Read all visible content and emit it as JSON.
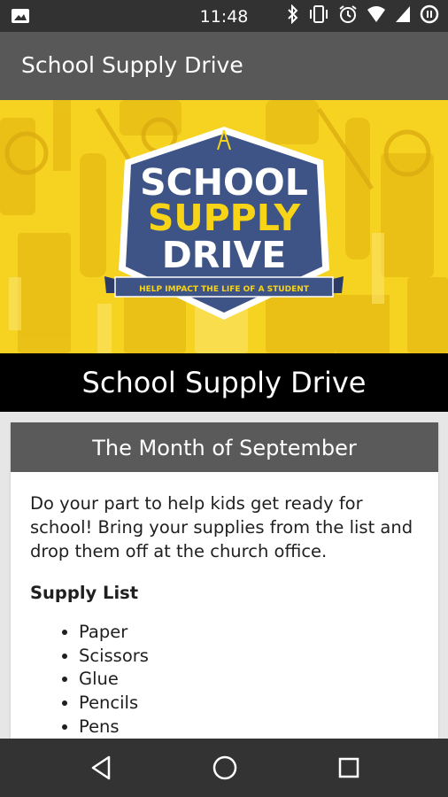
{
  "status_bar": {
    "time": "11:48",
    "icons": [
      "image-icon",
      "bluetooth-icon",
      "vibrate-icon",
      "alarm-icon",
      "wifi-icon",
      "cell-signal-icon",
      "data-saver-icon"
    ]
  },
  "app_bar": {
    "title": "School Supply Drive"
  },
  "banner": {
    "line1": "SCHOOL",
    "line2": "SUPPLY",
    "line3": "DRIVE",
    "ribbon": "HELP IMPACT THE LIFE OF A STUDENT",
    "colors": {
      "background": "#f5d320",
      "badge": "#3f5486",
      "accent_yellow": "#f7d418"
    }
  },
  "title_strip": {
    "text": "School Supply Drive"
  },
  "card": {
    "header": "The Month of September",
    "intro": "Do your part to help kids get ready for school! Bring your supplies from the list and drop them off at the church office.",
    "subheading": "Supply List",
    "items": [
      "Paper",
      "Scissors",
      "Glue",
      "Pencils",
      "Pens"
    ]
  },
  "nav_bar": {
    "buttons": [
      "back-icon",
      "home-icon",
      "recents-icon"
    ]
  }
}
